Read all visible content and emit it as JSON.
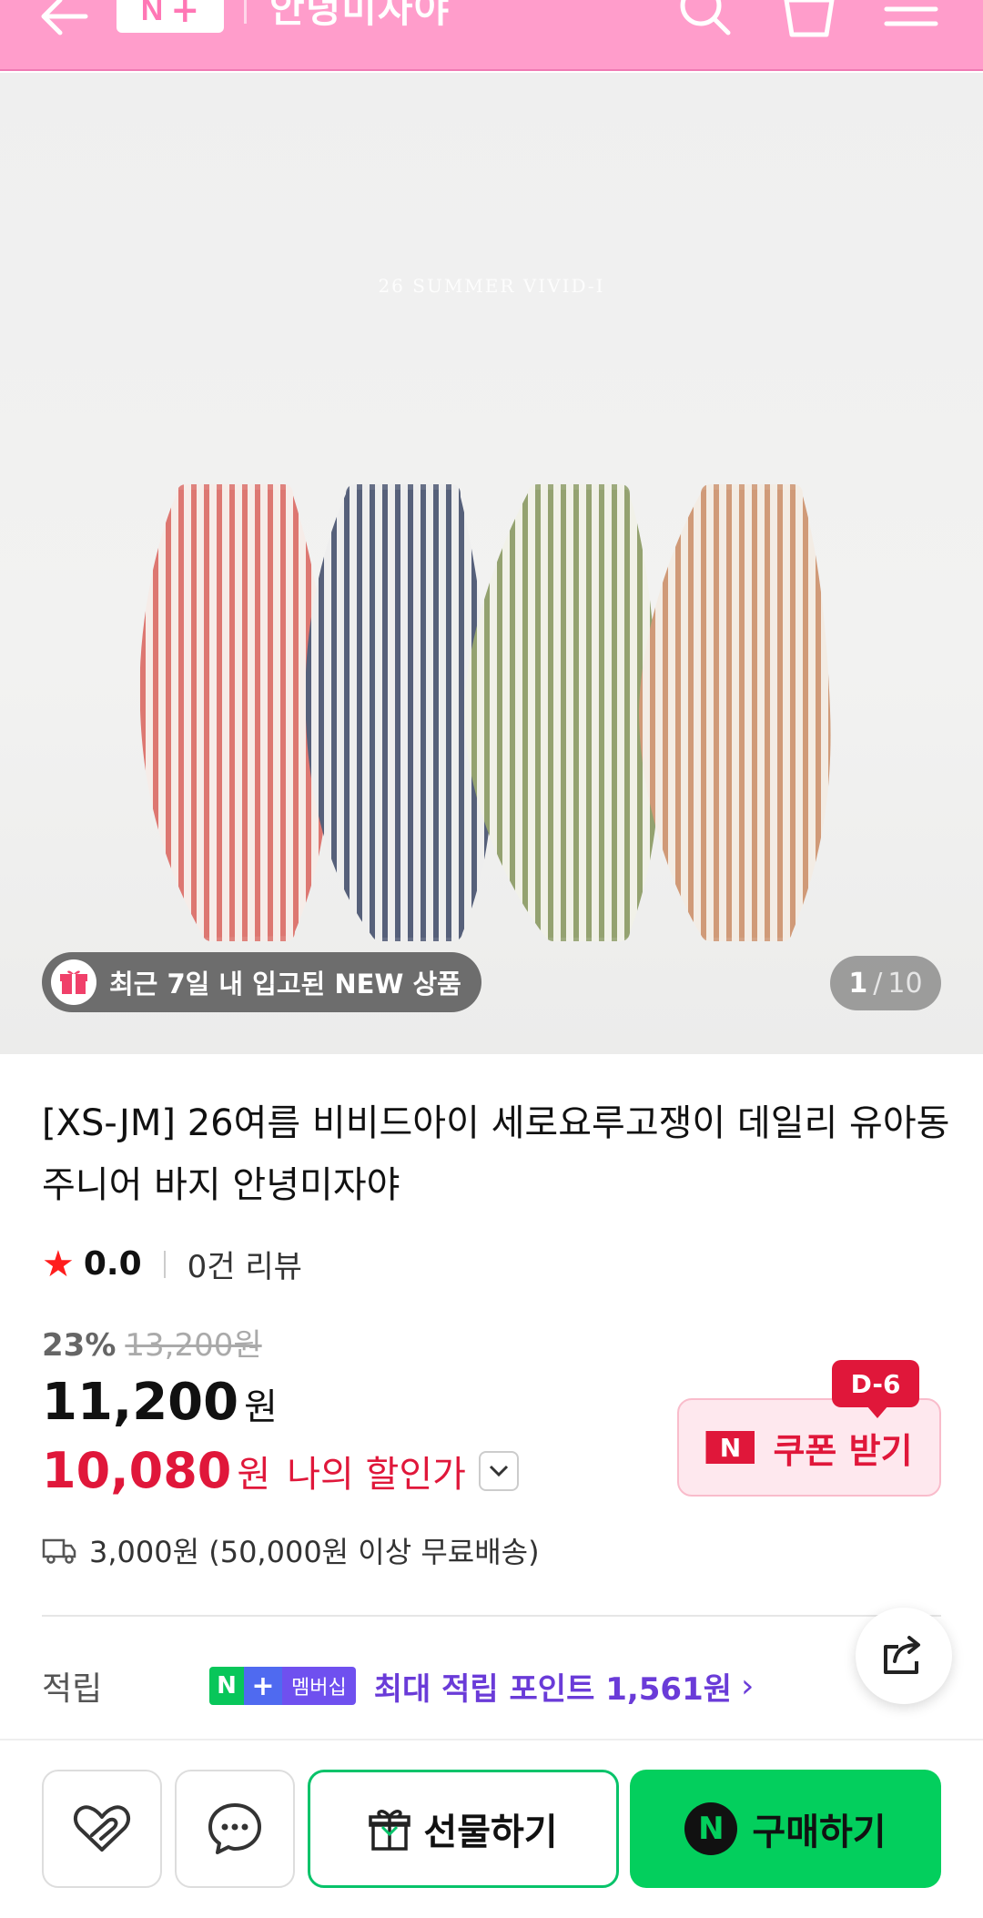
{
  "header": {
    "logo_letter": "N",
    "logo_plus": "+",
    "store_name": "안녕미자야",
    "icons": [
      "back-arrow-icon",
      "search-icon",
      "cart-icon",
      "menu-icon"
    ],
    "bg_color": "#ff9dcb"
  },
  "hero": {
    "caption": "26 SUMMER VIVID-I",
    "new_badge": "최근 7일 내 입고된 NEW 상품",
    "counter_current": "1",
    "counter_sep": "/",
    "counter_total": "10",
    "pants_colors": [
      "#e07d78",
      "#5a6275",
      "#9aa67a",
      "#d2a385"
    ]
  },
  "product": {
    "title": "[XS-JM] 26여름 비비드아이 세로요루고쟁이 데일리 유아동 주니어 바지 안녕미자야",
    "rating_score": "0.0",
    "reviews": "0건 리뷰",
    "discount_pct": "23%",
    "original_price": "13,200원",
    "price": "11,200",
    "price_unit": "원",
    "my_price": "10,080",
    "my_price_unit": "원",
    "my_price_label": "나의 할인가"
  },
  "coupon": {
    "dday": "D-6",
    "logo": "N",
    "label": "쿠폰 받기"
  },
  "shipping": {
    "text": "3,000원 (50,000원 이상 무료배송)"
  },
  "points": {
    "label": "적립",
    "badge_n": "N",
    "badge_plus": "+",
    "badge_text": "멤버십",
    "text": "최대 적립 포인트 1,561원",
    "chevron": "›"
  },
  "bottom_bar": {
    "gift_label": "선물하기",
    "buy_label": "구매하기",
    "buy_logo": "N",
    "accent": "#03cf5d"
  }
}
